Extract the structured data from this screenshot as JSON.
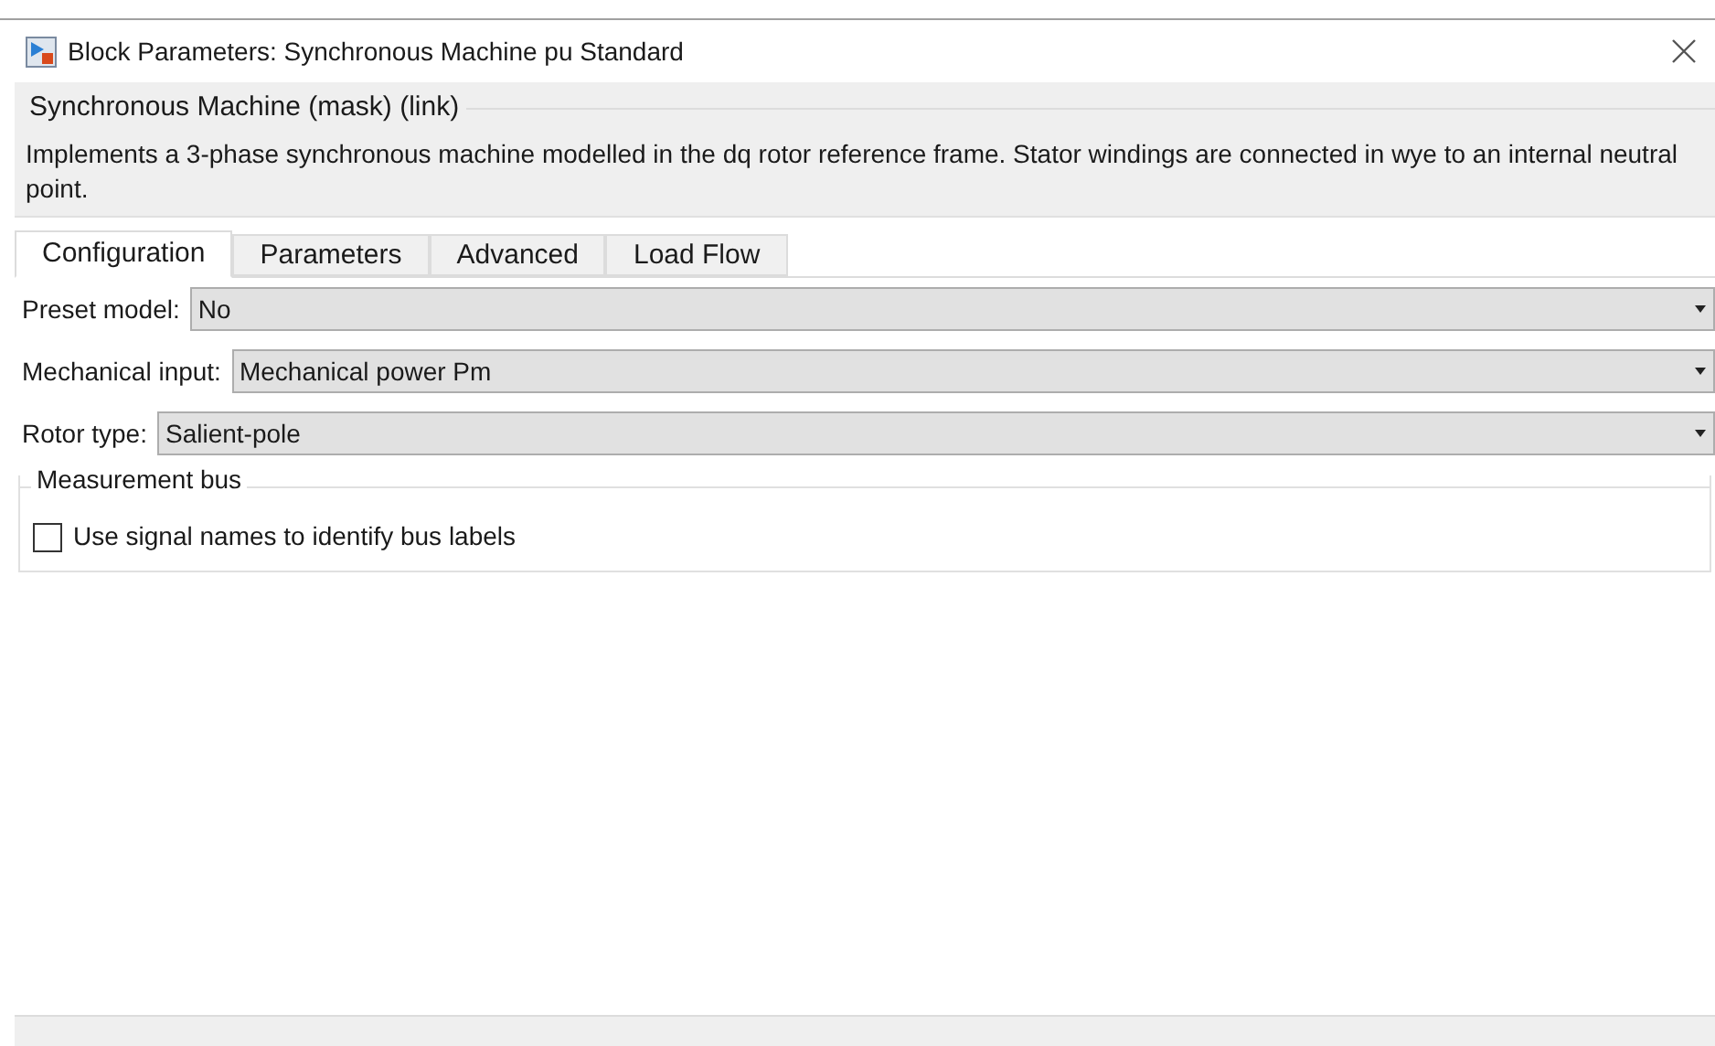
{
  "window": {
    "title": "Block Parameters: Synchronous Machine pu Standard"
  },
  "mask": {
    "title": "Synchronous Machine (mask) (link)",
    "description": "Implements a 3-phase synchronous machine modelled in the dq rotor reference frame. Stator windings are connected in wye to an internal neutral point."
  },
  "tabs": [
    {
      "label": "Configuration",
      "selected": true
    },
    {
      "label": "Parameters",
      "selected": false
    },
    {
      "label": "Advanced",
      "selected": false
    },
    {
      "label": "Load Flow",
      "selected": false
    }
  ],
  "fields": [
    {
      "label": "Preset  model:",
      "value": "No"
    },
    {
      "label": "Mechanical input:",
      "value": "Mechanical power Pm"
    },
    {
      "label": "Rotor type:",
      "value": "Salient-pole"
    }
  ],
  "measurement_bus": {
    "title": "Measurement bus",
    "checkbox": {
      "label": "Use signal names to identify bus labels",
      "checked": false
    }
  }
}
